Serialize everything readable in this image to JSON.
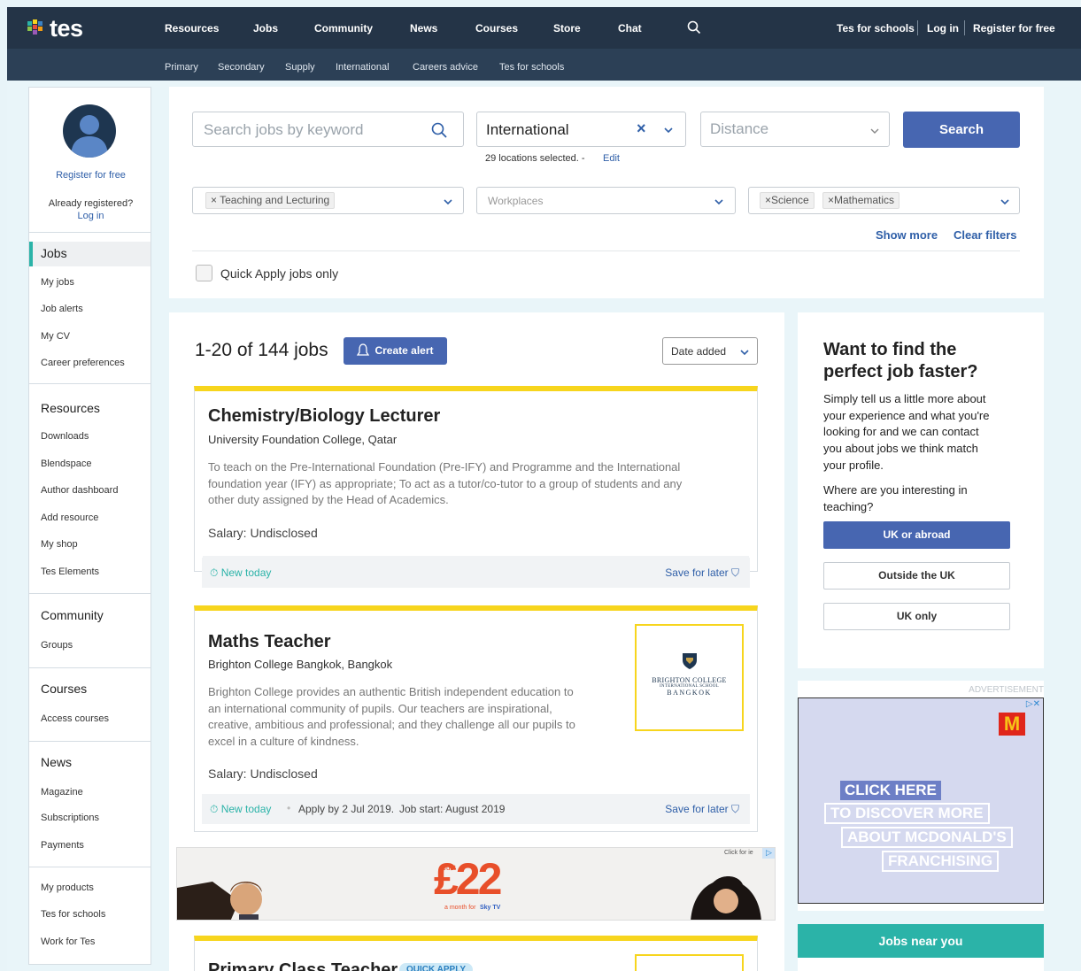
{
  "logo_text": "tes",
  "nav": {
    "items": [
      "Resources",
      "Jobs",
      "Community",
      "News",
      "Courses",
      "Store",
      "Chat"
    ],
    "right": [
      "Tes for schools",
      "Log in",
      "Register for free"
    ],
    "sub": [
      "Primary",
      "Secondary",
      "Supply",
      "International",
      "Careers advice",
      "Tes for schools"
    ]
  },
  "sidebar": {
    "register": "Register for free",
    "already": "Already registered?",
    "login": "Log in",
    "sections": [
      {
        "head": "Jobs",
        "items": [
          "My jobs",
          "Job alerts",
          "My CV",
          "Career preferences"
        ]
      },
      {
        "head": "Resources",
        "items": [
          "Downloads",
          "Blendspace",
          "Author dashboard",
          "Add resource",
          "My shop",
          "Tes Elements"
        ]
      },
      {
        "head": "Community",
        "items": [
          "Groups"
        ]
      },
      {
        "head": "Courses",
        "items": [
          "Access courses"
        ]
      },
      {
        "head": "News",
        "items": [
          "Magazine",
          "Subscriptions",
          "Payments"
        ]
      },
      {
        "head": "",
        "items": [
          "My products",
          "Tes for schools",
          "Work for Tes"
        ]
      }
    ]
  },
  "search": {
    "keyword_placeholder": "Search jobs by keyword",
    "location_value": "International",
    "locations_note": "29 locations selected. -",
    "edit_link": "Edit",
    "distance_placeholder": "Distance",
    "search_button": "Search",
    "filter1_chip": "Teaching and Lecturing",
    "filter2_placeholder": "Workplaces",
    "filter3_chips": [
      "Science",
      "Mathematics"
    ],
    "show_more": "Show more",
    "clear_filters": "Clear filters",
    "quick_apply": "Quick Apply jobs only"
  },
  "results": {
    "count": "1-20 of 144 jobs",
    "create_alert": "Create alert",
    "sort": "Date added"
  },
  "jobs": [
    {
      "title": "Chemistry/Biology Lecturer",
      "employer": "University Foundation College, Qatar",
      "description": [
        "To teach on the Pre-International Foundation (Pre-IFY) and Programme and the International",
        "foundation year (IFY) as appropriate; To act as a tutor/co-tutor to a group of students and any",
        "other duty assigned by the Head of Academics."
      ],
      "salary": "Salary: Undisclosed",
      "posted": "New today",
      "save": "Save for later"
    },
    {
      "title": "Maths Teacher",
      "employer": "Brighton College Bangkok, Bangkok",
      "description": [
        "Brighton College provides an authentic British independent education to",
        "an international community of pupils. Our teachers are inspirational,",
        "creative, ambitious and professional; and they challenge all our pupils to",
        "excel in a culture of kindness."
      ],
      "salary": "Salary: Undisclosed",
      "posted": "New today",
      "apply_by": "Apply by 2 Jul 2019.",
      "job_start": "Job start: August 2019",
      "save": "Save for later",
      "logo_lines": [
        "BRIGHTON COLLEGE",
        "INTERNATIONAL SCHOOL",
        "BANGKOK"
      ]
    },
    {
      "title": "Primary Class Teacher",
      "badge": "QUICK APPLY"
    }
  ],
  "banner_ad": {
    "click_for": "Click for ie",
    "just": "Just",
    "price": "£22",
    "per_month": "a month for",
    "brand": "Sky TV"
  },
  "promo": {
    "heading_1": "Want to find the",
    "heading_2": "perfect job faster?",
    "body": [
      "Simply tell us a little more about",
      "your experience and what you're",
      "looking for and we can contact",
      "you about jobs we think match",
      "your profile."
    ],
    "question": [
      "Where are you interesting in",
      "teaching?"
    ],
    "buttons": [
      "UK or abroad",
      "Outside the UK",
      "UK only"
    ]
  },
  "side_ad": {
    "label": "ADVERTISEMENT",
    "lines": [
      "CLICK HERE",
      "TO DISCOVER MORE",
      "ABOUT MCDONALD'S",
      "FRANCHISING"
    ]
  },
  "jobs_near": {
    "title": "Jobs near you"
  },
  "colors": {
    "nav_bg": "#243447",
    "accent_blue": "#4766b1",
    "teal": "#2bb3a8",
    "card_yellow": "#f7d51d"
  }
}
